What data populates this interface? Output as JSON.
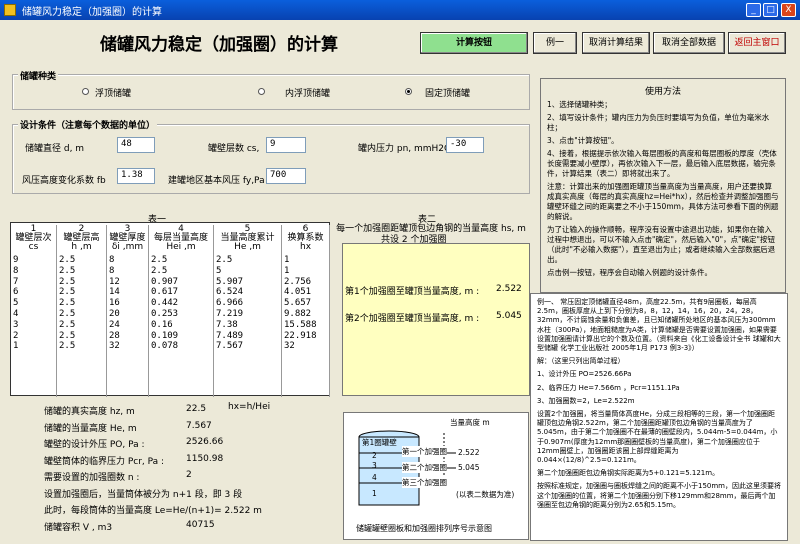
{
  "window": {
    "title": "储罐风力稳定（加强圈）的计算",
    "min": "_",
    "max": "□",
    "close": "X"
  },
  "header": {
    "title": "储罐风力稳定（加强圈）的计算"
  },
  "toolbar": {
    "calc": "计算按钮",
    "example": "例一",
    "clear_results": "取消计算结果",
    "clear_all": "取消全部数据",
    "back": "返回主窗口"
  },
  "tank_type": {
    "label": "储罐种类",
    "options": [
      "浮顶储罐",
      "内浮顶储罐",
      "固定顶储罐"
    ],
    "selected": 2
  },
  "design": {
    "label": "设计条件（注意每个数据的单位）",
    "diameter_label": "储罐直径 d, m",
    "diameter": "48",
    "layers_label": "罐壁层数 cs,",
    "layers": "9",
    "pressure_label": "罐内压力 pn, mmH2O",
    "pressure": "-30",
    "wind_label": "风压高度变化系数 fb",
    "wind": "1.38",
    "basewind_label": "建罐地区基本风压 fy,Pa",
    "basewind": "700"
  },
  "table1": {
    "title": "表一",
    "headers": [
      [
        "1",
        "罐壁层次",
        "cs"
      ],
      [
        "2",
        "罐壁层高",
        "h ,m"
      ],
      [
        "3",
        "罐壁厚度",
        "δi ,mm"
      ],
      [
        "4",
        "每层当量高度",
        "Hei ,m"
      ],
      [
        "5",
        "当量高度累计",
        "He ,m"
      ],
      [
        "6",
        "换算系数",
        "hx"
      ]
    ],
    "rows": [
      [
        "9",
        "2.5",
        "8",
        "2.5",
        "2.5",
        "1"
      ],
      [
        "8",
        "2.5",
        "8",
        "2.5",
        "5",
        "1"
      ],
      [
        "7",
        "2.5",
        "12",
        "0.907",
        "5.907",
        "2.756"
      ],
      [
        "6",
        "2.5",
        "14",
        "0.617",
        "6.524",
        "4.051"
      ],
      [
        "5",
        "2.5",
        "16",
        "0.442",
        "6.966",
        "5.657"
      ],
      [
        "4",
        "2.5",
        "20",
        "0.253",
        "7.219",
        "9.882"
      ],
      [
        "3",
        "2.5",
        "24",
        "0.16",
        "7.38",
        "15.588"
      ],
      [
        "2",
        "2.5",
        "28",
        "0.109",
        "7.489",
        "22.918"
      ],
      [
        "1",
        "2.5",
        "32",
        "0.078",
        "7.567",
        "32"
      ]
    ]
  },
  "table2": {
    "title": "表二",
    "header": "每一个加强圈距罐顶包边角钢的当量高度  hs, m",
    "count": "共设  2  个加强圈",
    "rows": [
      {
        "label": "第1个加强圈至罐顶当量高度, m :",
        "value": "2.522"
      },
      {
        "label": "第2个加强圈至罐顶当量高度, m :",
        "value": "5.045"
      }
    ]
  },
  "results": {
    "formula": "hx=h/Hei",
    "items": [
      {
        "label": "储罐的真实高度  hz, m",
        "value": "22.5"
      },
      {
        "label": "储罐的当量高度  He, m",
        "value": "7.567"
      },
      {
        "label": "罐壁的设计外压  PO,  Pa :",
        "value": "2526.66"
      },
      {
        "label": "罐壁筒体的临界压力  Pcr, Pa :",
        "value": "1150.98"
      },
      {
        "label": "需要设置的加强圈数 n :",
        "value": "2"
      },
      {
        "label": "设置加强圈后，当量筒体被分为  n+1 段，即 3 段",
        "value": ""
      },
      {
        "label": "此时，每段筒体的当量高度 Le=He/(n+1)= 2.522  m",
        "value": ""
      },
      {
        "label": "储罐容积  V , m3",
        "value": "40715"
      }
    ]
  },
  "help": {
    "title": "使用方法",
    "lines": [
      "1、选择储罐种类；",
      "2、填写设计条件；罐内压力为负压时要填写为负值，单位为毫米水柱；",
      "3、点击\"计算按钮\"。",
      "4、接着，根据提示依次输入每层圈板的高度和每层圈板的厚度（壳体长度需要减小壁厚），再依次输入下一层，最后输入底层数据，输完条件，计算结果（表二）即将就出来了。",
      "注意：计算出来的加强圈距罐顶当量高度为当量高度，用户还要换算成真实高度（每层的真实高度hz=Hei*hx），然后检查并调整加强圈与罐壁环缝之间的距离要之不小于150mm，具体方法可参看下面的例题的解说。",
      "为了让输入的操作顺畅，程序没有设置中途退出功能，如果你在输入过程中想退出，可以不输入点击\"确定\"，然后输入\"0\"，点\"确定\"按钮（此时\"不必输入数据\"），直至退出为止；或者继续输入全部数据后退出。",
      "点击例一按钮，程序会自动输入例题的设计条件。"
    ]
  },
  "example": {
    "lines": [
      "例一、 常压固定顶储罐直径48m，高度22.5m，共有9层圈板，每层高2.5m，圈板厚度从上到下分别为8，8，12，14，16，20，24，28，32mm，不计腐蚀余量和负偏差，且已知储罐所处地区的基本风压为300mm水柱（300Pa），地面粗糙度为A类，计算储罐是否需要设置加强圈，如果需要设置加强圈请计算出它的个数及位置。（资料来自《化工设备设计全书 球罐和大型储罐 化学工业出版社 2005年1月 P173 例3-3》）",
      "解：（这里只列出简单过程）",
      "1、设计外压 PO=2526.66Pa",
      "2、临界压力 He=7.566m ，Pcr=1151.1Pa",
      "3、加强圈数=2，Le=2.522m",
      "设置2个加强圈，将当量筒体高度He，分成三段相等的三段，第一个加强圈距罐顶包边角钢2.522m，第二个加强圈距罐顶包边角钢的当量高度为了5.045m，由于第二个加强圈不在最薄的圈壁段内，5.044m-5=0.044m，小于0.907m(厚度为12mm那圈圈壁板的当量高度)，第二个加强圈应位于12mm圈壁上，加强圈距该圈上部焊缝距离为0.044×(12/8)^2.5=0.121m。",
      "第二个加强圈距包边角钢实际距离为5+0.121=5.121m。",
      "按照标准规定，加强圈与圈板焊缝之间的距离不小于150mm，因此这里须要将这个加强圈的位置，将第二个加强圈分别下移129mm和28mm，最后两个加强圈至包边角钢的距离分别为2.65和5.15m。"
    ]
  },
  "diagram": {
    "top_label": "当量高度 m",
    "tank_label": "第1圈罐壁",
    "layer_labels": [
      "2",
      "3",
      "4",
      "1"
    ],
    "ring_labels": [
      "第一个加强圈",
      "第二个加强圈",
      "第三个加强圈"
    ],
    "values": [
      "2.522",
      "5.045"
    ],
    "note": "(以表二数据为准)",
    "caption": "储罐罐壁圈板和加强圈排列序号示意图"
  }
}
